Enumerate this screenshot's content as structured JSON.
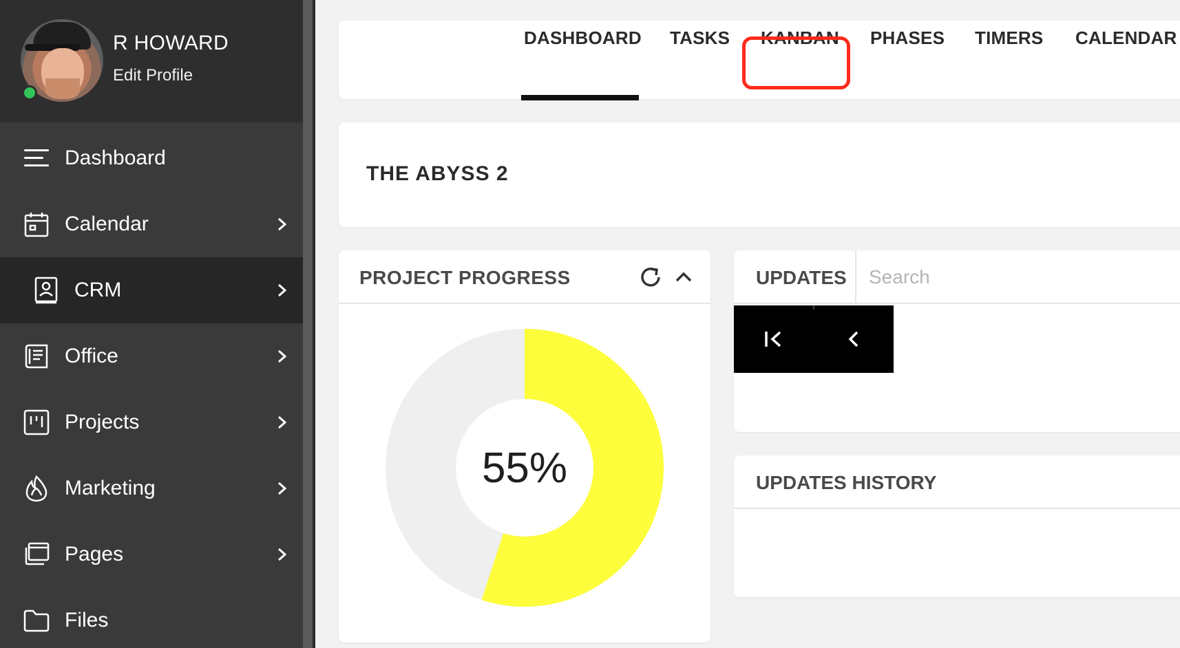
{
  "user": {
    "name": "R HOWARD",
    "edit_label": "Edit Profile",
    "status_color": "#33c45a"
  },
  "sidebar": {
    "items": [
      {
        "label": "Dashboard",
        "icon": "menu-icon",
        "has_chevron": false
      },
      {
        "label": "Calendar",
        "icon": "calendar-icon",
        "has_chevron": true
      },
      {
        "label": "CRM",
        "icon": "contact-card-icon",
        "has_chevron": true,
        "active": true
      },
      {
        "label": "Office",
        "icon": "office-document-icon",
        "has_chevron": true
      },
      {
        "label": "Projects",
        "icon": "project-board-icon",
        "has_chevron": true
      },
      {
        "label": "Marketing",
        "icon": "flame-icon",
        "has_chevron": true
      },
      {
        "label": "Pages",
        "icon": "pages-icon",
        "has_chevron": true
      },
      {
        "label": "Files",
        "icon": "folder-icon",
        "has_chevron": false
      }
    ]
  },
  "tabs": {
    "items": [
      "DASHBOARD",
      "TASKS",
      "KANBAN",
      "PHASES",
      "TIMERS",
      "CALENDAR"
    ],
    "active": "DASHBOARD",
    "highlighted": "KANBAN",
    "highlight_color": "#ff2b1c"
  },
  "project": {
    "title": "THE ABYSS 2"
  },
  "progress": {
    "title": "PROJECT PROGRESS",
    "value": 0.55,
    "label": "55%",
    "fill_color": "#fdfd3c",
    "track_color": "#efefef"
  },
  "updates": {
    "title": "UPDATES",
    "search_placeholder": "Search",
    "pager": [
      "first-page-icon",
      "previous-page-icon"
    ]
  },
  "history": {
    "title": "UPDATES HISTORY"
  }
}
